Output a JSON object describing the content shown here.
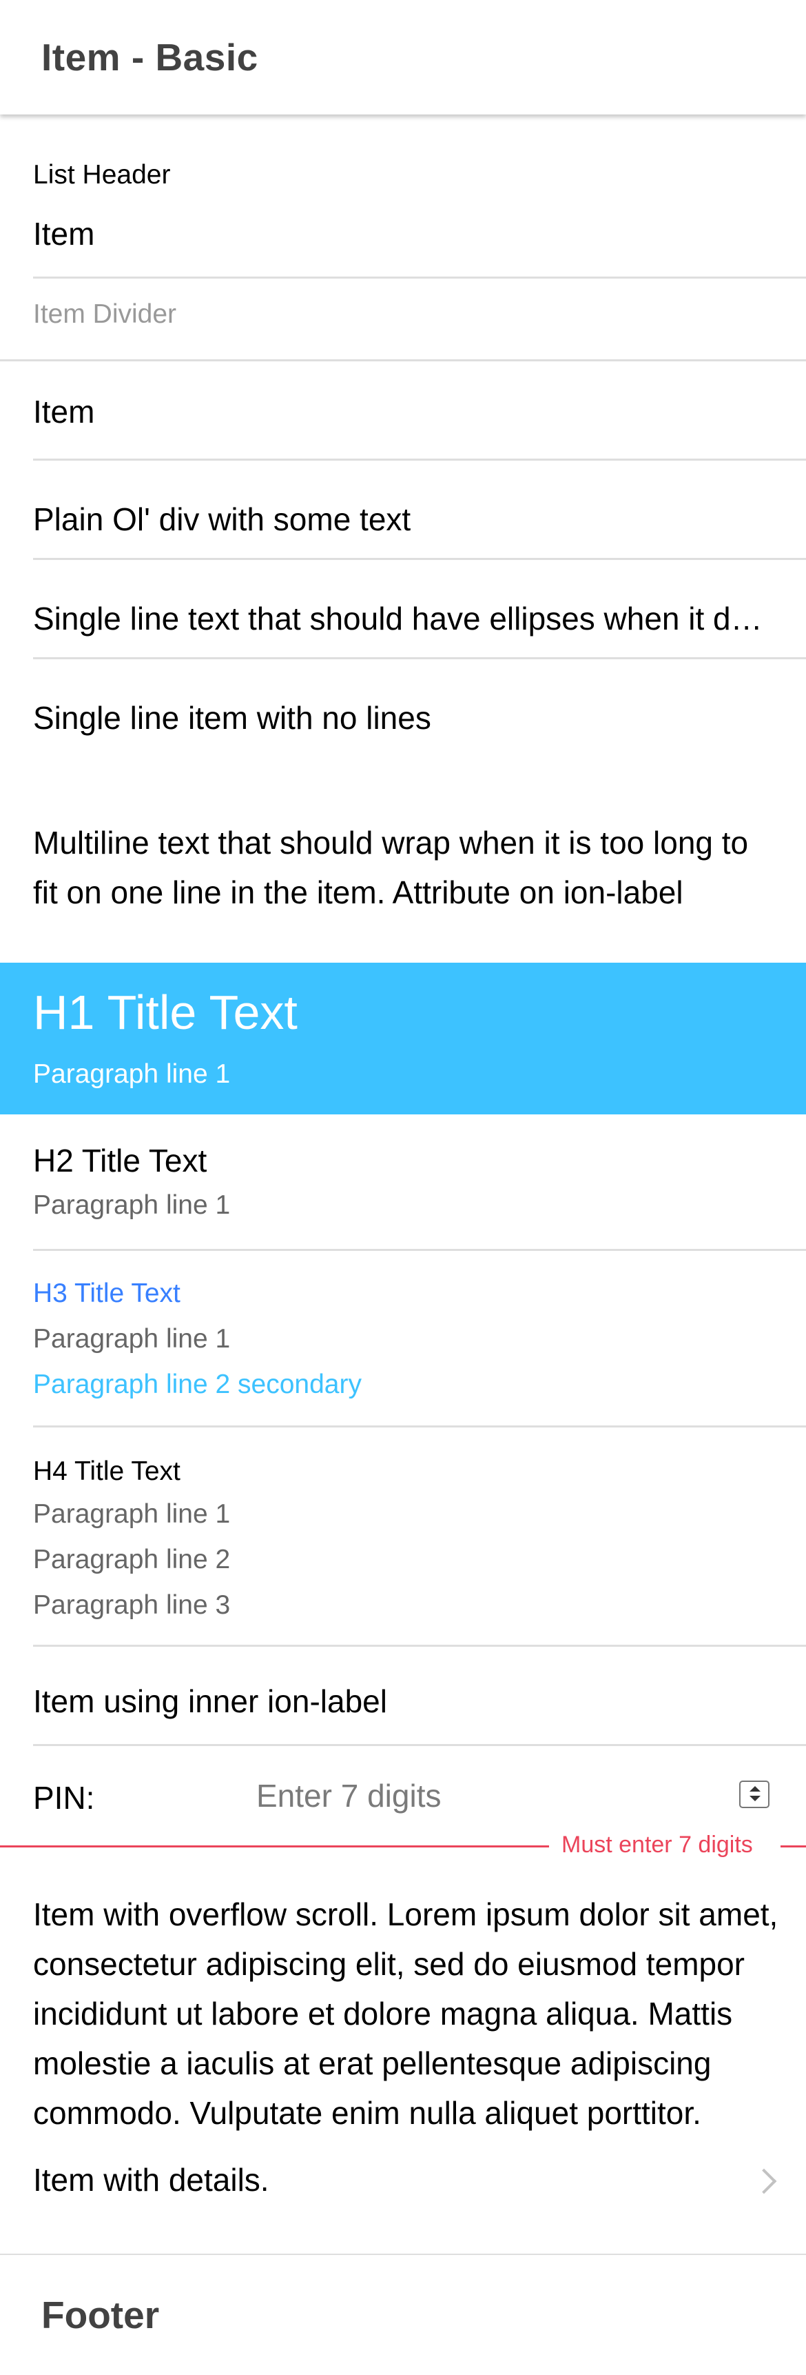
{
  "header": {
    "title": "Item - Basic"
  },
  "list": {
    "list_header": "List Header",
    "item_1": "Item",
    "divider": "Item Divider",
    "item_2": "Item",
    "plain_div": "Plain Ol' div with some text",
    "ellipsis_text": "Single line text that should have ellipses when it doesn't all fit in the item",
    "no_lines": "Single line item with no lines",
    "multiline": "Multiline text that should wrap when it is too long to fit on one line in the item. Attribute on ion-label",
    "h1": {
      "title": "H1 Title Text",
      "para": "Paragraph line 1",
      "background": "#3dc2ff"
    },
    "h2": {
      "title": "H2 Title Text",
      "para": "Paragraph line 1"
    },
    "h3": {
      "title": "H3 Title Text",
      "para": "Paragraph line 1",
      "secondary": "Paragraph line 2 secondary"
    },
    "h4": {
      "title": "H4 Title Text",
      "para1": "Paragraph line 1",
      "para2": "Paragraph line 2",
      "para3": "Paragraph line 3"
    },
    "inner_label": "Item using inner ion-label",
    "pin": {
      "label": "PIN:",
      "placeholder": "Enter 7 digits",
      "error": "Must enter 7 digits"
    },
    "overflow_text": "Item with overflow scroll. Lorem ipsum dolor sit amet, consectetur adipiscing elit, sed do eiusmod tempor incididunt ut labore et dolore magna aliqua. Mattis molestie a iaculis at erat pellentesque adipiscing commodo. Vulputate enim nulla aliquet porttitor. Fermentum dui faucibus in ornare quam viverra orci.",
    "details": "Item with details."
  },
  "footer": {
    "title": "Footer"
  },
  "colors": {
    "primary": "#3880ff",
    "secondary": "#3dc2ff",
    "danger": "#eb445a"
  },
  "icons": {
    "details": "chevron-forward-icon",
    "stepper": "number-stepper-icon"
  }
}
